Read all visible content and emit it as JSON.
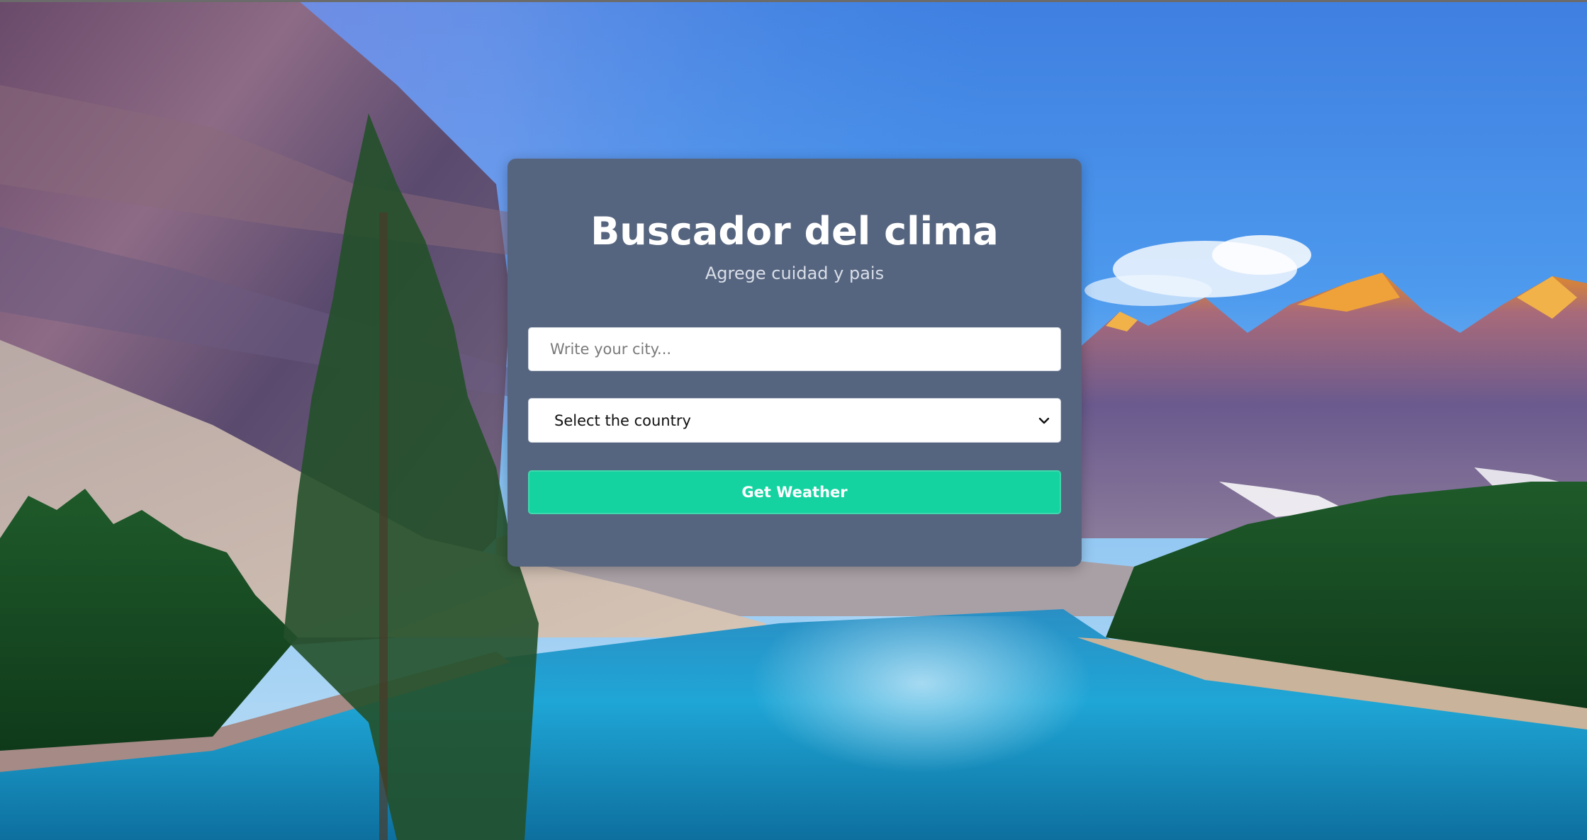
{
  "form": {
    "title": "Buscador del clima",
    "subtitle": "Agrege cuidad y pais",
    "city_input": {
      "placeholder": "Write your city...",
      "value": ""
    },
    "country_select": {
      "selected": "Select the country"
    },
    "submit_label": "Get Weather"
  },
  "colors": {
    "card": "#56657f",
    "button": "#14d3a1",
    "title": "#ffffff",
    "subtitle": "#d9dee8"
  },
  "icons": {
    "select_chevron": "chevron-down-icon"
  }
}
